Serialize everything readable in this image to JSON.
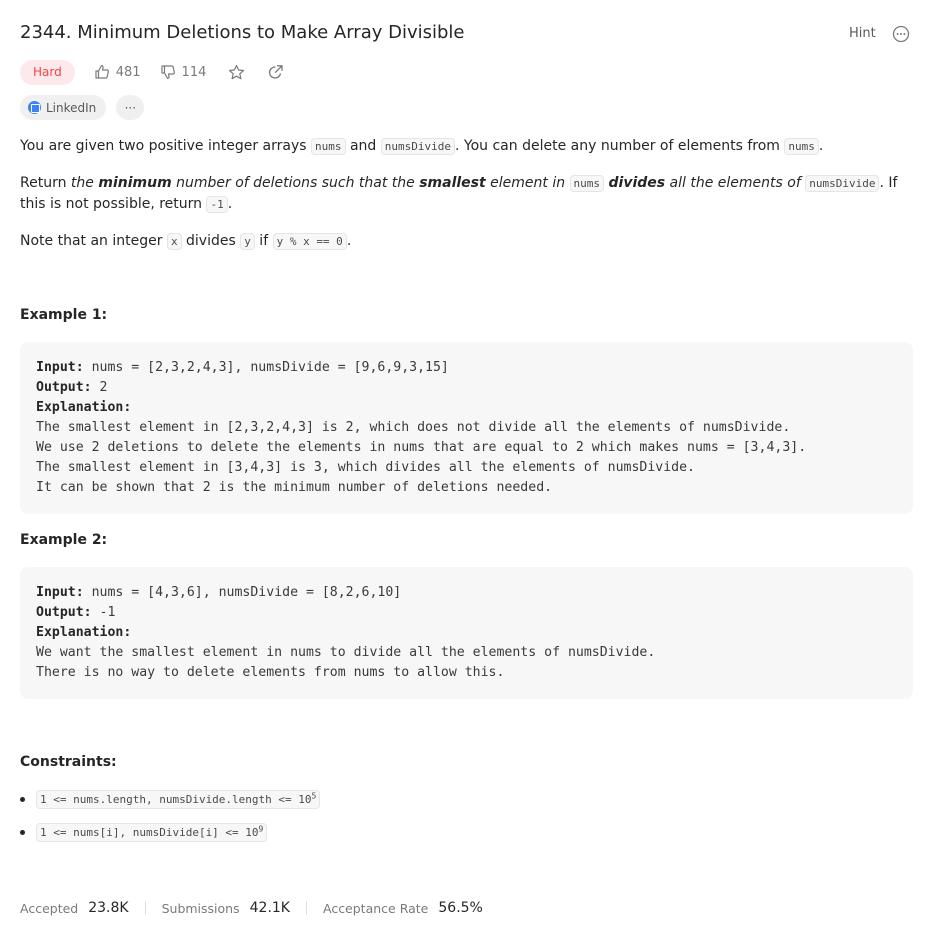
{
  "problem": {
    "title": "2344. Minimum Deletions to Make Array Divisible",
    "hint_label": "Hint",
    "difficulty": "Hard",
    "likes": "481",
    "dislikes": "114",
    "company_tag": "LinkedIn",
    "more_tags": "···"
  },
  "description": {
    "p1": {
      "t1": "You are given two positive integer arrays ",
      "c1": "nums",
      "t2": " and ",
      "c2": "numsDivide",
      "t3": ". You can delete any number of elements from ",
      "c3": "nums",
      "t4": "."
    },
    "p2": {
      "t1": "Return ",
      "i1": "the ",
      "b1": "minimum",
      "i2": " number of deletions such that the ",
      "b2": "smallest",
      "i3": " element in ",
      "c1": "nums",
      "b3": "divides",
      "i4": " all the elements of ",
      "c2": "numsDivide",
      "t2": ". If this is not possible, return ",
      "c3": "-1",
      "t3": "."
    },
    "p3": {
      "t1": "Note that an integer ",
      "c1": "x",
      "t2": " divides ",
      "c2": "y",
      "t3": " if ",
      "c3": "y % x == 0",
      "t4": "."
    }
  },
  "examples": [
    {
      "heading": "Example 1:",
      "input_label": "Input:",
      "input": " nums = [2,3,2,4,3], numsDivide = [9,6,9,3,15]",
      "output_label": "Output:",
      "output": " 2",
      "explanation_label": "Explanation:",
      "explanation": [
        "The smallest element in [2,3,2,4,3] is 2, which does not divide all the elements of numsDivide.",
        "We use 2 deletions to delete the elements in nums that are equal to 2 which makes nums = [3,4,3].",
        "The smallest element in [3,4,3] is 3, which divides all the elements of numsDivide.",
        "It can be shown that 2 is the minimum number of deletions needed."
      ]
    },
    {
      "heading": "Example 2:",
      "input_label": "Input:",
      "input": " nums = [4,3,6], numsDivide = [8,2,6,10]",
      "output_label": "Output:",
      "output": " -1",
      "explanation_label": "Explanation:",
      "explanation": [
        "We want the smallest element in nums to divide all the elements of numsDivide.",
        "There is no way to delete elements from nums to allow this."
      ]
    }
  ],
  "constraints": {
    "heading": "Constraints:",
    "items": [
      {
        "text": "1 <= nums.length, numsDivide.length <= 10",
        "sup": "5"
      },
      {
        "text": "1 <= nums[i], numsDivide[i] <= 10",
        "sup": "9"
      }
    ]
  },
  "stats": {
    "accepted_label": "Accepted",
    "accepted_value": "23.8K",
    "submissions_label": "Submissions",
    "submissions_value": "42.1K",
    "rate_label": "Acceptance Rate",
    "rate_value": "56.5%"
  },
  "colors": {
    "hard_text": "#ef4743",
    "hard_bg": "#fde9ec",
    "tag_bg": "#f0f0f0",
    "code_block_bg": "#f7f7f8"
  },
  "icons": [
    "thumbs-up-icon",
    "thumbs-down-icon",
    "star-icon",
    "share-icon",
    "more-circle-icon",
    "linkedin-icon"
  ]
}
